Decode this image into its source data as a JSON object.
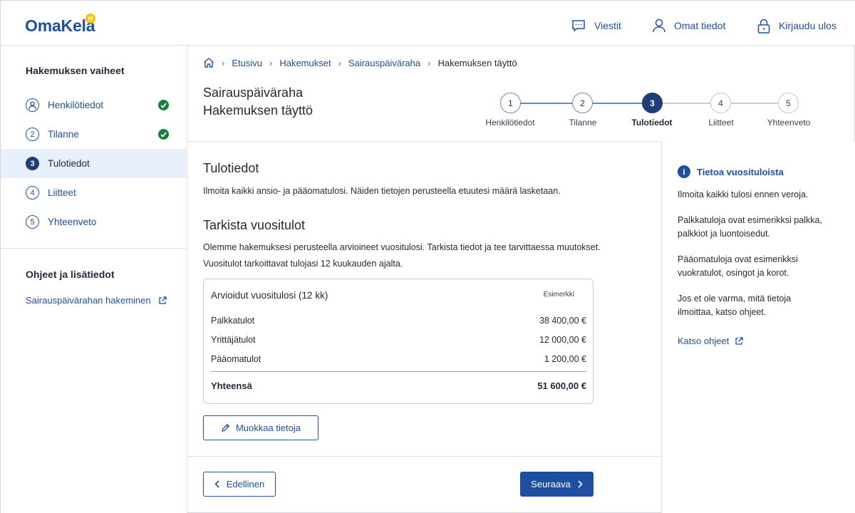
{
  "header": {
    "logo": "OmaKela",
    "logo_badge": "H",
    "messages": "Viestit",
    "profile": "Omat tiedot",
    "logout": "Kirjaudu ulos"
  },
  "sidebar": {
    "title": "Hakemuksen vaiheet",
    "items": [
      {
        "num": "1",
        "label": "Henkilötiedot",
        "done": true
      },
      {
        "num": "2",
        "label": "Tilanne",
        "done": true
      },
      {
        "num": "3",
        "label": "Tulotiedot",
        "done": false
      },
      {
        "num": "4",
        "label": "Liitteet",
        "done": false
      },
      {
        "num": "5",
        "label": "Yhteenveto",
        "done": false
      }
    ],
    "help_title": "Ohjeet ja lisätiedot",
    "help_link": "Sairauspäivärahan hakeminen"
  },
  "breadcrumb": {
    "items": [
      "Etusivu",
      "Hakemukset",
      "Sairauspäiväraha"
    ],
    "current": "Hakemuksen täyttö"
  },
  "page": {
    "title": "Sairauspäiväraha",
    "subtitle": "Hakemuksen täyttö"
  },
  "stepper": {
    "current_step": 3,
    "steps": [
      {
        "num": "1",
        "label": "Henkilötiedot"
      },
      {
        "num": "2",
        "label": "Tilanne"
      },
      {
        "num": "3",
        "label": "Tulotiedot"
      },
      {
        "num": "4",
        "label": "Liitteet"
      },
      {
        "num": "5",
        "label": "Yhteenveto"
      }
    ]
  },
  "content": {
    "heading": "Tulotiedot",
    "intro": "Ilmoita kaikki ansio- ja pääomatulosi. Näiden tietojen perusteella etuutesi määrä lasketaan.",
    "check_heading": "Tarkista vuositulot",
    "check_p1": "Olemme hakemuksesi perusteella arvioineet vuositulosi. Tarkista tiedot ja tee tarvittaessa muutokset.",
    "check_p2": "Vuositulot tarkoittavat tulojasi 12 kuukauden ajalta."
  },
  "income_card": {
    "title": "Arvioidut vuositulosi (12 kk)",
    "tag": "Esimerkki",
    "rows": [
      {
        "label": "Palkkatulot",
        "value": "38 400,00 €"
      },
      {
        "label": "Yrittäjätulot",
        "value": "12 000,00 €"
      },
      {
        "label": "Pääomatulot",
        "value": "1 200,00 €"
      }
    ],
    "total_label": "Yhteensä",
    "total_value": "51 600,00 €"
  },
  "buttons": {
    "edit": "Muokkaa tietoja",
    "previous": "Edellinen",
    "next": "Seuraava"
  },
  "info_panel": {
    "title": "Tietoa vuosituloista",
    "p1": "Ilmoita kaikki tulosi ennen veroja.",
    "p2": "Palkkatuloja ovat esimerikksi palkka, palkkiot ja luontoisedut.",
    "p3": "Pääomatuloja ovat esimerikksi vuokratulot, osingot ja korot.",
    "p4": "Jos et ole varma, mitä tietoja ilmoittaa, katso ohjeet.",
    "link": "Katso ohjeet"
  },
  "colors": {
    "brand": "#1f4fa3",
    "active_bg": "#e8f0fb",
    "success": "#16803c",
    "step_current": "#1e3e78"
  }
}
